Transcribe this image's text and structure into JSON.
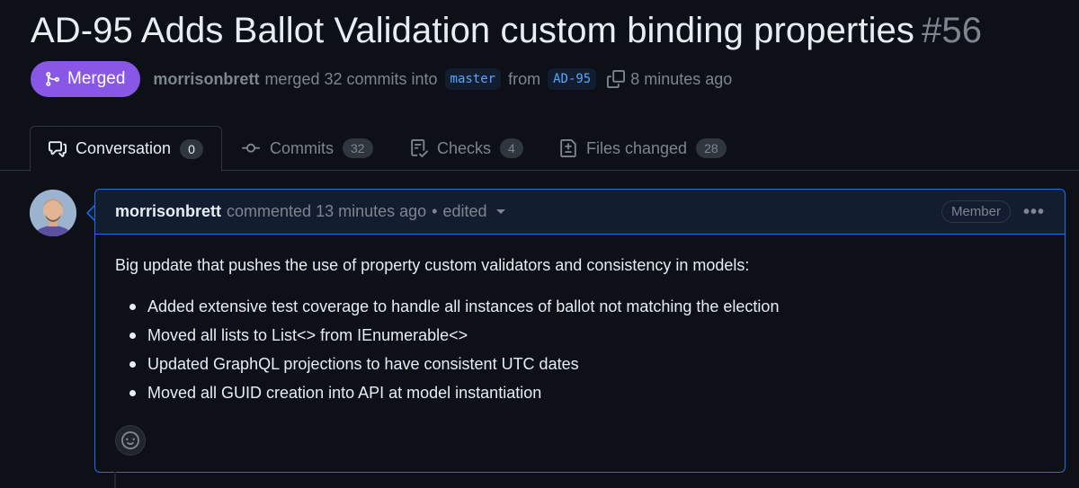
{
  "pr": {
    "title": "AD-95 Adds Ballot Validation custom binding properties",
    "number": "#56",
    "state": "Merged",
    "author": "morrisonbrett",
    "merge_text": "merged 32 commits into",
    "base_branch": "master",
    "from_text": "from",
    "head_branch": "AD-95",
    "time": "8 minutes ago"
  },
  "tabs": [
    {
      "label": "Conversation",
      "count": "0",
      "icon": "comment-discussion-icon"
    },
    {
      "label": "Commits",
      "count": "32",
      "icon": "git-commit-icon"
    },
    {
      "label": "Checks",
      "count": "4",
      "icon": "checklist-icon"
    },
    {
      "label": "Files changed",
      "count": "28",
      "icon": "file-diff-icon"
    }
  ],
  "comment": {
    "author": "morrisonbrett",
    "action": "commented",
    "time": "13 minutes ago",
    "dot": "•",
    "edited": "edited",
    "role": "Member",
    "more": "•••",
    "intro": "Big update that pushes the use of property custom validators and consistency in models:",
    "bullets": [
      "Added extensive test coverage to handle all instances of ballot not matching the election",
      "Moved all lists to List<> from IEnumerable<>",
      "Updated GraphQL projections to have consistent UTC dates",
      "Moved all GUID creation into API at model instantiation"
    ]
  },
  "colors": {
    "background": "#0d1117",
    "merged": "#8957e5",
    "accent": "#1f6feb",
    "muted": "#7d8590",
    "link": "#58a6ff"
  }
}
